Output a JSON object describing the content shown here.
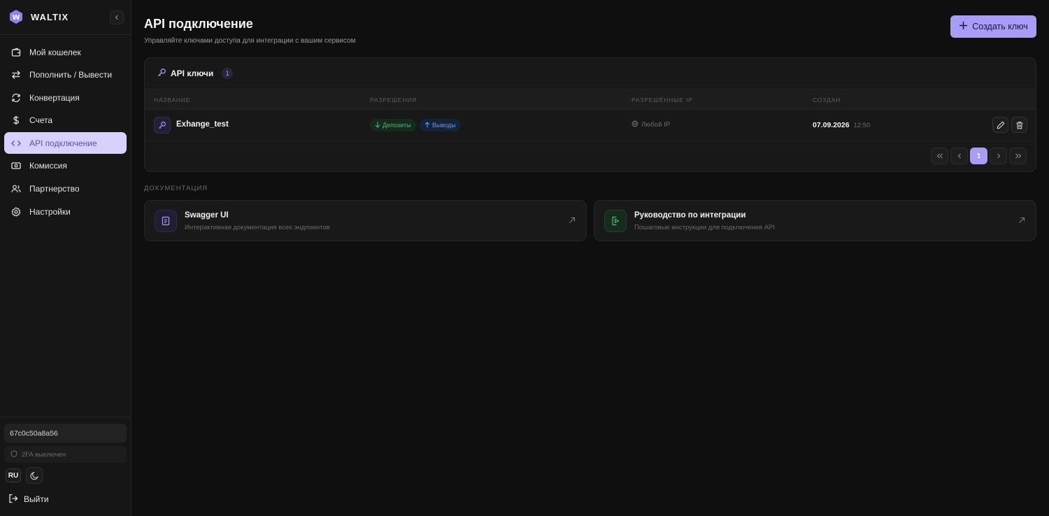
{
  "sidebar": {
    "brand": "WALTIX",
    "nav": [
      {
        "label": "Мой кошелек",
        "icon": "wallet-icon"
      },
      {
        "label": "Пополнить / Вывести",
        "icon": "transfer-arrows-icon"
      },
      {
        "label": "Конвертация",
        "icon": "refresh-icon"
      },
      {
        "label": "Счета",
        "icon": "dollar-icon"
      },
      {
        "label": "API подключение",
        "icon": "code-icon",
        "active": true
      },
      {
        "label": "Комиссия",
        "icon": "banknote-icon"
      },
      {
        "label": "Партнерство",
        "icon": "users-icon"
      },
      {
        "label": "Настройки",
        "icon": "gear-icon"
      }
    ],
    "account_id": "67c0c50a8a56",
    "twofa_status": "2FA выключен",
    "language": "RU",
    "logout_label": "Выйти"
  },
  "header": {
    "title": "API подключение",
    "subtitle": "Управляйте ключами доступа для интеграции с вашим сервисом",
    "create_button": "Создать ключ"
  },
  "keys_table": {
    "title": "API ключи",
    "count": "1",
    "columns": [
      "Название",
      "Разрешения",
      "Разрешённые IP",
      "Создан"
    ],
    "rows": [
      {
        "name": "Exhange_test",
        "permissions": [
          "Депозиты",
          "Выводы"
        ],
        "allowed_ip": "Любой IP",
        "created_date": "07.09.2026",
        "created_time": "12:50"
      }
    ],
    "pagination": {
      "current_page": "1"
    }
  },
  "docs": {
    "section_label": "ДОКУМЕНТАЦИЯ",
    "cards": [
      {
        "title": "Swagger UI",
        "subtitle": "Интерактивная документация всех эндпоинтов",
        "icon": "document-icon"
      },
      {
        "title": "Руководство по интеграции",
        "subtitle": "Пошаговые инструкции для подключения API",
        "icon": "play-file-icon"
      }
    ]
  },
  "colors": {
    "accent": "#a79cf6",
    "active_nav_bg": "#d7d1fb",
    "deposit_green": "#3fc16e",
    "withdraw_blue": "#5b9cf2",
    "background": "#0f0f0f"
  }
}
